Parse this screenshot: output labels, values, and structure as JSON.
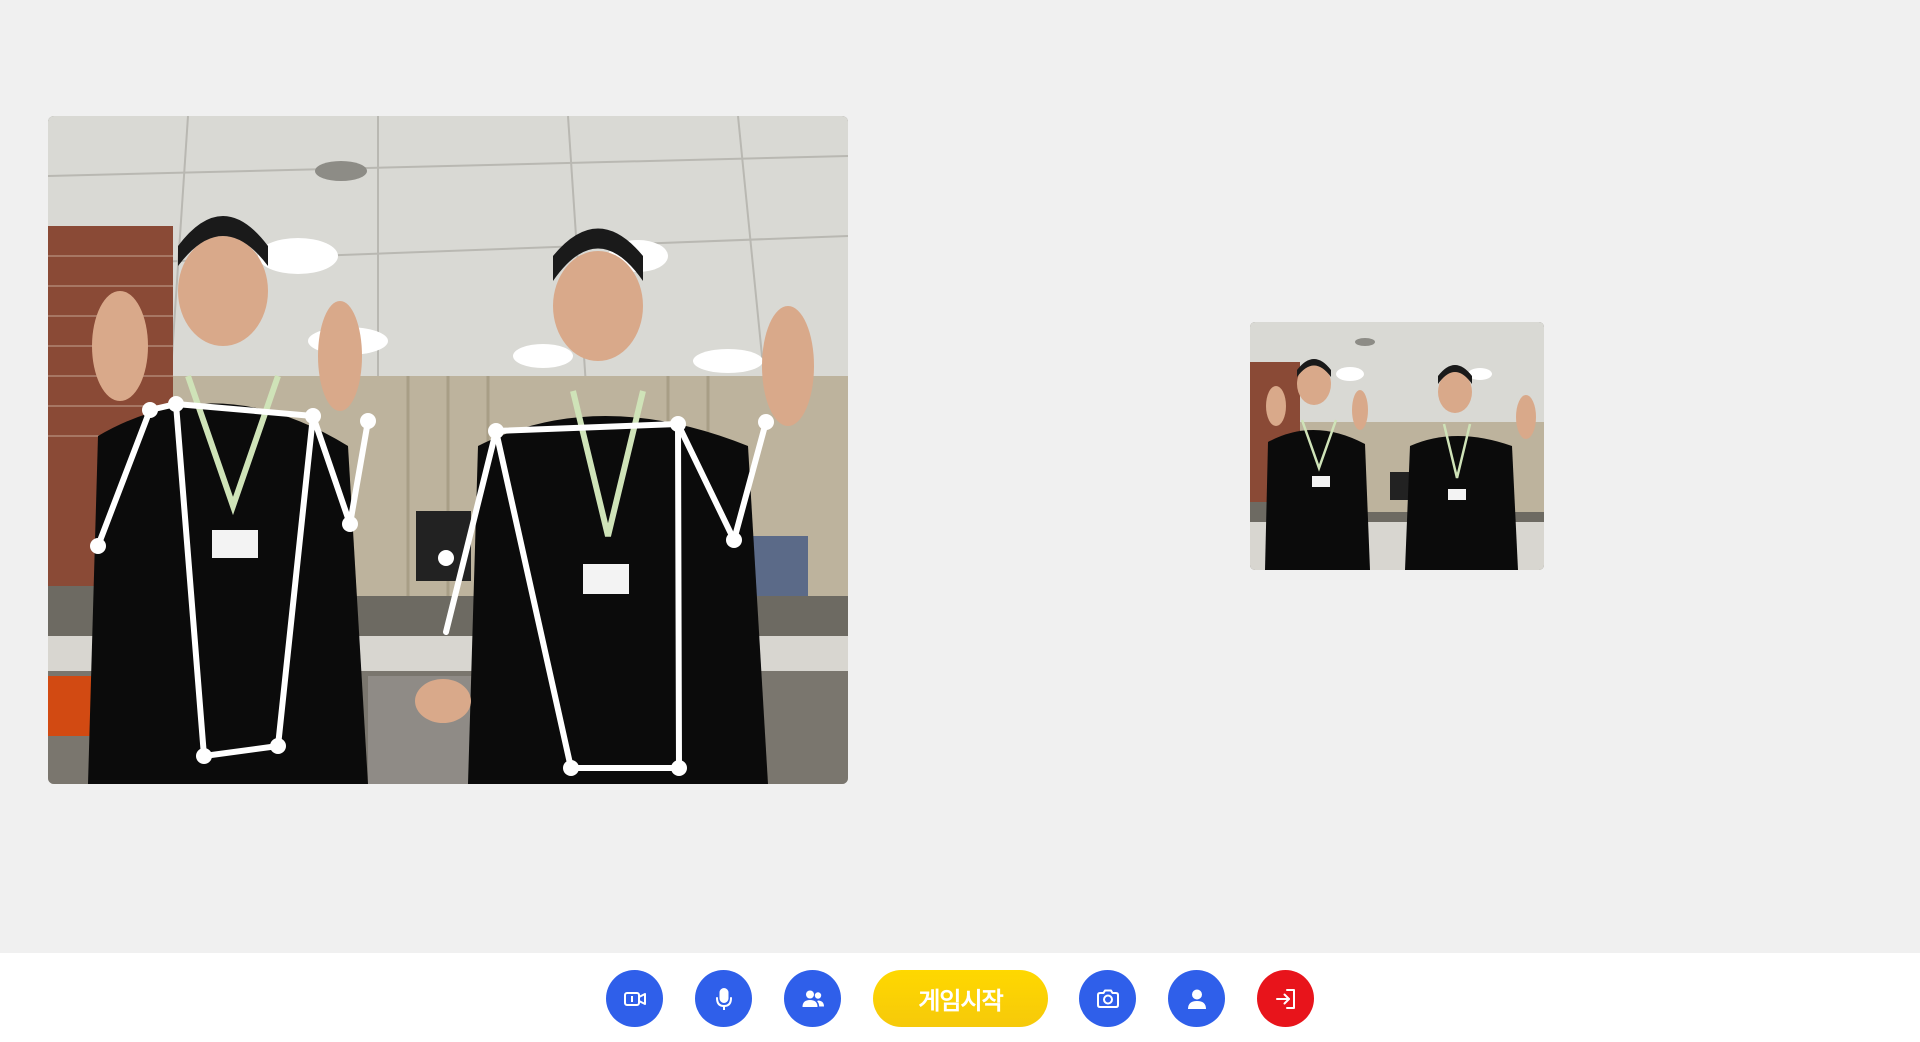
{
  "videos": {
    "main": {
      "label": "local-camera-feed",
      "pose_overlay": true
    },
    "remote": {
      "label": "remote-camera-feed"
    }
  },
  "toolbar": {
    "buttons": [
      {
        "name": "video-toggle-button",
        "icon": "video-camera-icon"
      },
      {
        "name": "mic-toggle-button",
        "icon": "microphone-icon"
      },
      {
        "name": "participants-button",
        "icon": "users-icon"
      },
      {
        "name": "screenshot-button",
        "icon": "camera-icon"
      },
      {
        "name": "profile-button",
        "icon": "user-icon"
      },
      {
        "name": "exit-button",
        "icon": "exit-icon"
      }
    ],
    "start_label": "게임시작"
  },
  "colors": {
    "primary_button": "#2f5fea",
    "exit_button": "#e8141b",
    "start_button": "#ffd800",
    "toolbar_bg": "#ffffff",
    "stage_bg": "#f0f0f0"
  }
}
